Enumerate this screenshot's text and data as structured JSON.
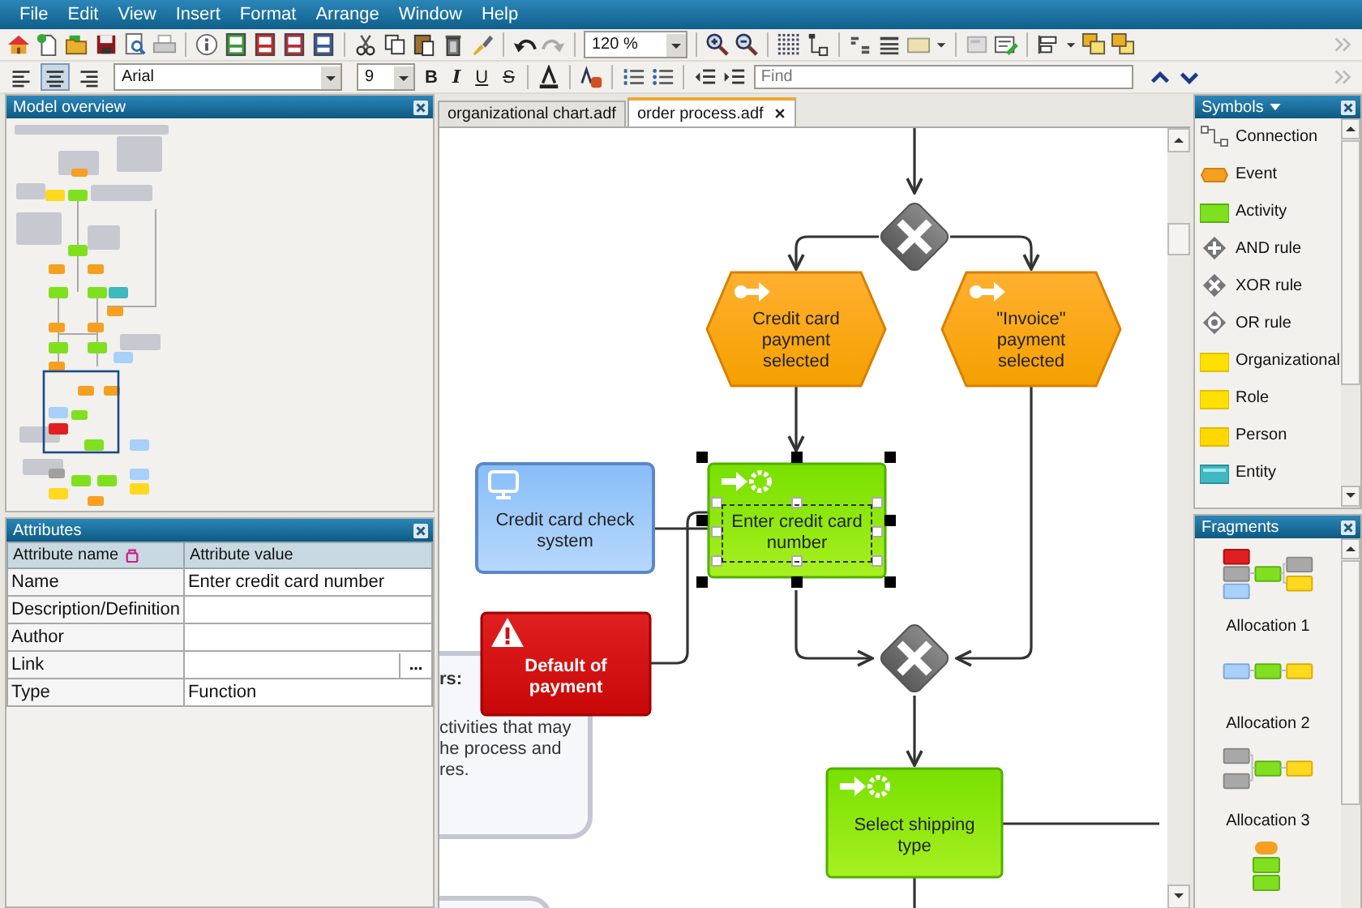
{
  "menu": [
    "File",
    "Edit",
    "View",
    "Insert",
    "Format",
    "Arrange",
    "Window",
    "Help"
  ],
  "toolbar": {
    "zoom": "120 %",
    "font": "Arial",
    "font_size": "9",
    "alignment": [
      {
        "kind": "left",
        "selected": false
      },
      {
        "kind": "center",
        "selected": true
      },
      {
        "kind": "right",
        "selected": false
      }
    ],
    "format_buttons": [
      {
        "label": "B",
        "kind": "bold"
      },
      {
        "label": "I",
        "kind": "italic"
      },
      {
        "label": "U",
        "kind": "underline"
      },
      {
        "label": "S",
        "kind": "strike"
      }
    ],
    "find": {
      "placeholder": "Find"
    }
  },
  "overview": {
    "title": "Model overview"
  },
  "attributes": {
    "title": "Attributes",
    "columns": [
      "Attribute name",
      "Attribute value"
    ],
    "rows": [
      {
        "name": "Name",
        "value": "Enter credit card number"
      },
      {
        "name": "Description/Definition"
      },
      {
        "name": "Author"
      },
      {
        "name": "Link",
        "button": "..."
      },
      {
        "name": "Type",
        "value": "Function"
      }
    ]
  },
  "tabs": [
    {
      "label": "organizational chart.adf",
      "selected": false
    },
    {
      "label": "order process.adf",
      "selected": true
    }
  ],
  "diagram": {
    "nodes": [
      {
        "kind": "xor"
      },
      {
        "kind": "event",
        "label": "Credit card payment selected"
      },
      {
        "kind": "event",
        "label": "\"Invoice\" payment selected"
      },
      {
        "kind": "system",
        "label": "Credit card check system"
      },
      {
        "kind": "activity",
        "label": "Enter credit card number",
        "selected": true
      },
      {
        "kind": "risk",
        "label": "Default of payment"
      },
      {
        "kind": "note",
        "title": "rs:",
        "text": "ctivities that may\nhe process and\nres."
      },
      {
        "kind": "xor"
      },
      {
        "kind": "activity",
        "label": "Select shipping type",
        "selected": false
      },
      {
        "kind": "note"
      }
    ]
  },
  "symbols": {
    "title": "Symbols",
    "items": [
      {
        "label": "Connection",
        "kind": "connection"
      },
      {
        "label": "Event",
        "kind": "event"
      },
      {
        "label": "Activity",
        "kind": "activity"
      },
      {
        "label": "AND rule",
        "kind": "and"
      },
      {
        "label": "XOR rule",
        "kind": "xor"
      },
      {
        "label": "OR rule",
        "kind": "or"
      },
      {
        "label": "Organizational",
        "kind": "unit"
      },
      {
        "label": "Role",
        "kind": "role"
      },
      {
        "label": "Person",
        "kind": "person"
      },
      {
        "label": "Entity",
        "kind": "entity"
      }
    ]
  },
  "fragments": {
    "title": "Fragments",
    "items": [
      {
        "label": "Allocation 1",
        "kind": "mixed"
      },
      {
        "label": "Allocation 2",
        "kind": "row"
      },
      {
        "label": "Allocation 3",
        "kind": "pair"
      },
      {
        "kind": "stack"
      }
    ]
  }
}
